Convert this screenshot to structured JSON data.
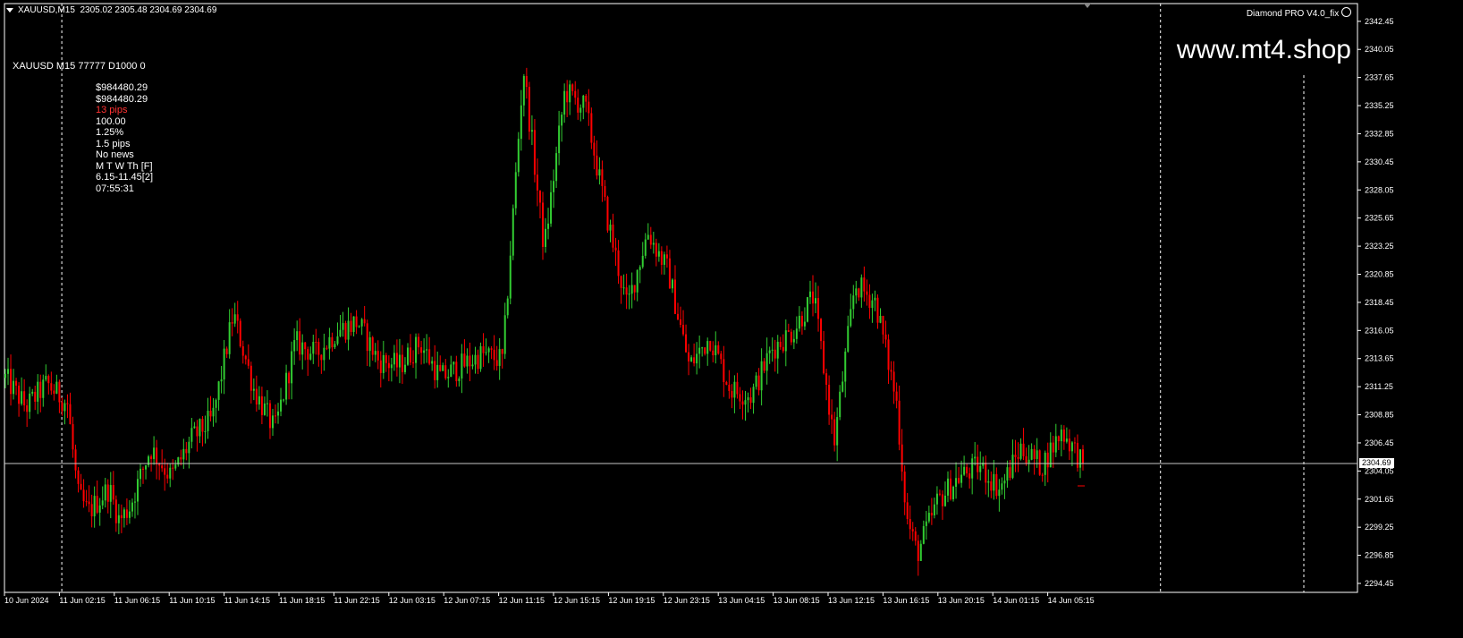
{
  "header": {
    "symbol_timeframe": "XAUUSD,M15",
    "ohlc": "2305.02 2305.48 2304.69 2304.69"
  },
  "indicator_label": "Diamond PRO V4.0_fix",
  "watermark": "www.mt4.shop",
  "info_panel": {
    "title": "XAUUSD M15 77777  D1000 0",
    "lines": [
      {
        "text": "$984480.29",
        "color": "#ffffff"
      },
      {
        "text": "$984480.29",
        "color": "#ffffff"
      },
      {
        "text": "13 pips",
        "color": "#ff3333"
      },
      {
        "text": "100.00",
        "color": "#ffffff"
      },
      {
        "text": "1.25%",
        "color": "#ffffff"
      },
      {
        "text": "1.5 pips",
        "color": "#ffffff"
      },
      {
        "text": "No news",
        "color": "#ffffff"
      },
      {
        "text": "M T W Th [F]",
        "color": "#ffffff"
      },
      {
        "text": "6.15-11.45[2]",
        "color": "#ffffff"
      },
      {
        "text": "07:55:31",
        "color": "#ffffff"
      }
    ]
  },
  "current_price": "2304.69",
  "colors": {
    "bull": "#32cd32",
    "bear": "#ff0000",
    "grid": "#ffffff",
    "axis": "#ffffff"
  },
  "chart_data": {
    "type": "candlestick",
    "symbol": "XAUUSD",
    "timeframe": "M15",
    "ylim": [
      2294.45,
      2343.2
    ],
    "y_ticks": [
      "2342.45",
      "2340.05",
      "2337.65",
      "2335.25",
      "2332.85",
      "2330.45",
      "2328.05",
      "2325.65",
      "2323.25",
      "2320.85",
      "2318.45",
      "2316.05",
      "2313.65",
      "2311.25",
      "2308.85",
      "2306.45",
      "2304.05",
      "2301.65",
      "2299.25",
      "2296.85",
      "2294.45"
    ],
    "x_ticks": [
      "10 Jun 2024",
      "11 Jun 02:15",
      "11 Jun 06:15",
      "11 Jun 10:15",
      "11 Jun 14:15",
      "11 Jun 18:15",
      "11 Jun 22:15",
      "12 Jun 03:15",
      "12 Jun 07:15",
      "12 Jun 11:15",
      "12 Jun 15:15",
      "12 Jun 19:15",
      "12 Jun 23:15",
      "13 Jun 04:15",
      "13 Jun 08:15",
      "13 Jun 12:15",
      "13 Jun 16:15",
      "13 Jun 20:15",
      "14 Jun 01:15",
      "14 Jun 05:15"
    ],
    "session_separators_after_tick": [
      0.3,
      6.05,
      11.85,
      17.7,
      23.5
    ],
    "close_path": [
      [
        0,
        2312.0
      ],
      [
        1,
        2309.5
      ],
      [
        2,
        2311.5
      ],
      [
        3,
        2309.8
      ],
      [
        3.5,
        2302.0
      ],
      [
        4,
        2300.5
      ],
      [
        5,
        2302.6
      ],
      [
        5.5,
        2299.8
      ],
      [
        6,
        2301.0
      ],
      [
        7,
        2306.0
      ],
      [
        8,
        2303.5
      ],
      [
        9,
        2306.8
      ],
      [
        10,
        2308.5
      ],
      [
        11,
        2317.5
      ],
      [
        12,
        2311.0
      ],
      [
        13,
        2307.5
      ],
      [
        14,
        2315.0
      ],
      [
        15,
        2314.0
      ],
      [
        16,
        2316.0
      ],
      [
        17,
        2316.8
      ],
      [
        18,
        2313.5
      ],
      [
        19,
        2313.0
      ],
      [
        20,
        2315.0
      ],
      [
        21,
        2312.0
      ],
      [
        22,
        2313.0
      ],
      [
        23,
        2314.0
      ],
      [
        24,
        2313.5
      ],
      [
        25,
        2338.5
      ],
      [
        26,
        2323.0
      ],
      [
        27,
        2336.5
      ],
      [
        28,
        2335.0
      ],
      [
        29,
        2326.0
      ],
      [
        30,
        2318.0
      ],
      [
        31,
        2324.5
      ],
      [
        32,
        2321.0
      ],
      [
        33,
        2313.0
      ],
      [
        34,
        2315.5
      ],
      [
        35,
        2311.0
      ],
      [
        36,
        2310.5
      ],
      [
        37,
        2314.5
      ],
      [
        38,
        2316.0
      ],
      [
        39,
        2319.0
      ],
      [
        40,
        2306.5
      ],
      [
        41,
        2320.0
      ],
      [
        42,
        2318.5
      ],
      [
        43,
        2310.0
      ],
      [
        43.5,
        2300.0
      ],
      [
        44,
        2297.0
      ],
      [
        45,
        2301.5
      ],
      [
        46,
        2303.5
      ],
      [
        47,
        2304.5
      ],
      [
        48,
        2302.5
      ],
      [
        49,
        2306.0
      ],
      [
        50,
        2304.5
      ],
      [
        51,
        2307.5
      ],
      [
        52,
        2304.69
      ]
    ]
  }
}
